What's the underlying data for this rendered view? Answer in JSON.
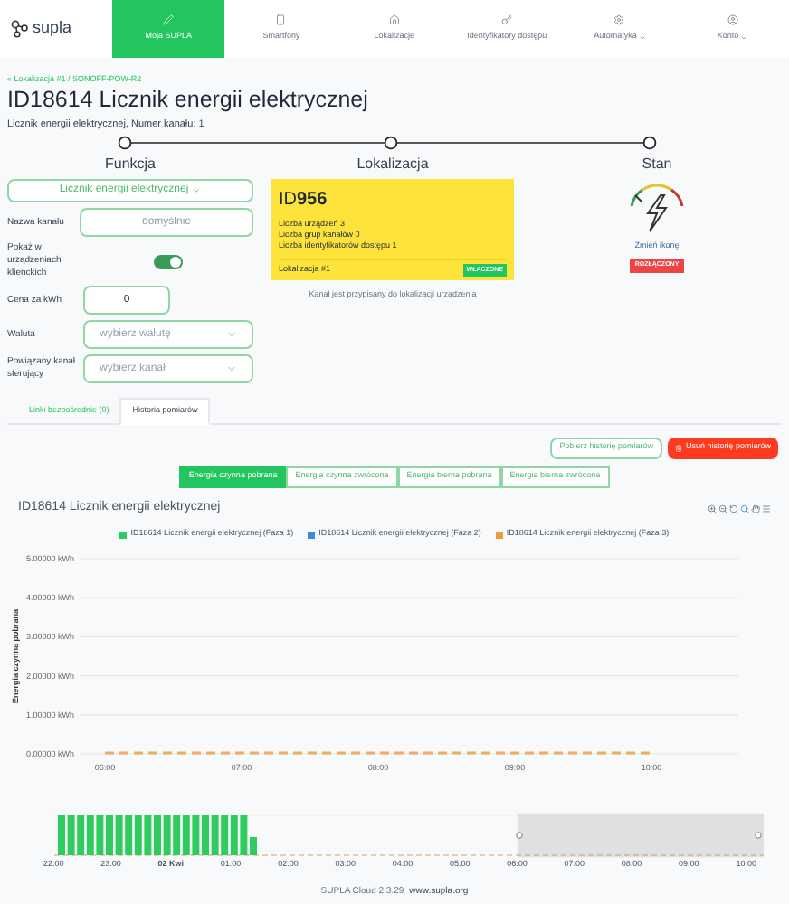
{
  "nav": {
    "logo": "supla",
    "items": [
      {
        "label": "Moja SUPLA",
        "selected": true,
        "dropdown": false
      },
      {
        "label": "Smartfony",
        "selected": false,
        "dropdown": false
      },
      {
        "label": "Lokalizacje",
        "selected": false,
        "dropdown": false
      },
      {
        "label": "Identyfikatory dostępu",
        "selected": false,
        "dropdown": false
      },
      {
        "label": "Automatyka",
        "selected": false,
        "dropdown": true
      },
      {
        "label": "Konto",
        "selected": false,
        "dropdown": true
      }
    ]
  },
  "breadcrumb": "« Lokalizacja #1 / SONOFF-POW-R2",
  "title": "ID18614 Licznik energii elektrycznej",
  "subtitle": "Licznik energii elektrycznej, Numer kanału: 1",
  "funkcja": {
    "heading": "Funkcja",
    "function_button": "Licznik energii elektrycznej",
    "fields": [
      {
        "kind": "text",
        "label": "Nazwa kanału",
        "placeholder": "domyślnie"
      },
      {
        "kind": "toggle",
        "label": "Pokaż w urządzeniach klienckich",
        "on": true
      },
      {
        "kind": "number",
        "label": "Cena za kWh",
        "value": "0"
      },
      {
        "kind": "select",
        "label": "Waluta",
        "placeholder": "wybierz walutę"
      },
      {
        "kind": "select",
        "label": "Powiązany kanał sterujący",
        "placeholder": "wybierz kanał"
      }
    ]
  },
  "lokalizacja": {
    "heading": "Lokalizacja",
    "id": "ID**956**",
    "lines": [
      "Liczba urządzeń 3",
      "Liczba grup kanałów 0",
      "Liczba identyfikatorów dostępu 1"
    ],
    "name": "Lokalizacja #1",
    "badge": "WŁĄCZONE",
    "note": "Kanał jest przypisany do lokalizacji urządzenia"
  },
  "stan": {
    "heading": "Stan",
    "link": "Zmień ikonę",
    "badge": "ROZŁĄCZONY"
  },
  "tabs": [
    {
      "label": "Linki bezpośrednie (0)",
      "selected": false
    },
    {
      "label": "Historia pomiarów",
      "selected": true
    }
  ],
  "buttons": [
    {
      "label": "Pobierz historię pomiarów",
      "kind": "outline"
    },
    {
      "label": "Usuń historię pomiarów",
      "kind": "danger"
    }
  ],
  "energy_tabs": [
    {
      "label": "Energia czynna pobrana",
      "selected": true
    },
    {
      "label": "Energia czynna zwrócona",
      "selected": false
    },
    {
      "label": "Energia bierna pobrana",
      "selected": false
    },
    {
      "label": "Energia bierna zwrócona",
      "selected": false
    }
  ],
  "chart_title": "ID18614 Licznik energii elektrycznej",
  "chart_data": {
    "type": "line",
    "ylabel": "Energia czynna pobrana",
    "categories": [
      "06:00",
      "07:00",
      "08:00",
      "09:00",
      "10:00"
    ],
    "ylim": [
      0,
      5
    ],
    "grid": true,
    "legend": true,
    "yticks": [
      {
        "value": 0,
        "label": "0.00000 kWh"
      },
      {
        "value": 1,
        "label": "1.00000 kWh"
      },
      {
        "value": 2,
        "label": "2.00000 kWh"
      },
      {
        "value": 3,
        "label": "3.00000 kWh"
      },
      {
        "value": 4,
        "label": "4.00000 kWh"
      },
      {
        "value": 5,
        "label": "5.00000 kWh"
      }
    ],
    "series": [
      {
        "name": "ID18614 Licznik energii elektrycznej (Faza 1)",
        "color": "#2ecc5f",
        "values": [
          null,
          null,
          null,
          null,
          null
        ]
      },
      {
        "name": "ID18614 Licznik energii elektrycznej (Faza 2)",
        "color": "#2f8fe0",
        "values": [
          null,
          null,
          null,
          null,
          null
        ]
      },
      {
        "name": "ID18614 Licznik energii elektrycznej (Faza 3)",
        "color": "#f09a3e",
        "line_style": "dashed",
        "values": [
          0,
          0,
          0,
          0,
          0
        ]
      }
    ]
  },
  "navigator": {
    "ticks": [
      {
        "label": "22:00",
        "bold": false
      },
      {
        "label": "23:00",
        "bold": false
      },
      {
        "label": "02 Kwi",
        "bold": true
      },
      {
        "label": "01:00",
        "bold": false
      },
      {
        "label": "02:00",
        "bold": false
      },
      {
        "label": "03:00",
        "bold": false
      },
      {
        "label": "04:00",
        "bold": false
      },
      {
        "label": "05:00",
        "bold": false
      },
      {
        "label": "06:00",
        "bold": false
      },
      {
        "label": "07:00",
        "bold": false
      },
      {
        "label": "08:00",
        "bold": false
      },
      {
        "label": "09:00",
        "bold": false
      },
      {
        "label": "10:00",
        "bold": false
      }
    ]
  },
  "footer": {
    "version": "SUPLA Cloud 2.3.29",
    "link": "www.supla.org"
  }
}
